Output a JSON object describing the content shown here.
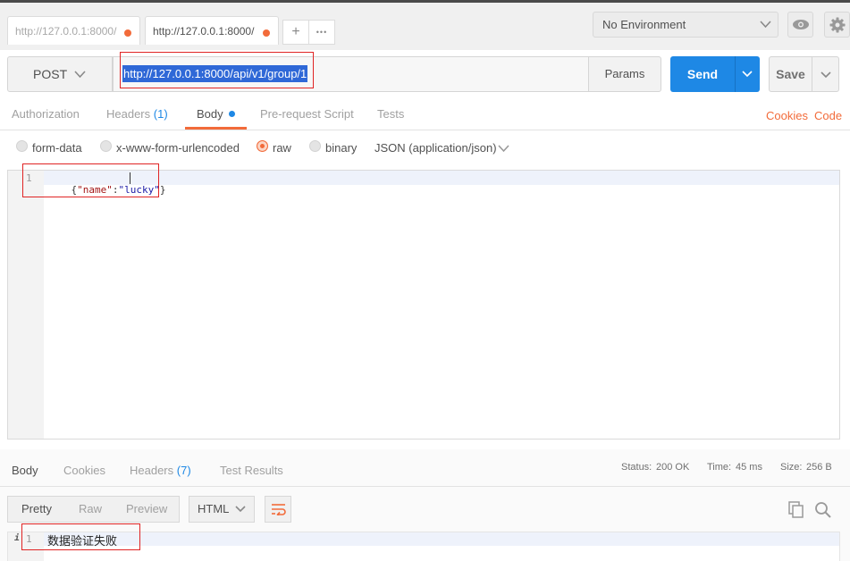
{
  "tabs": [
    {
      "label": "http://127.0.0.1:8000/"
    },
    {
      "label": "http://127.0.0.1:8000/"
    }
  ],
  "tab_add": "+",
  "tab_more": "•••",
  "environment": {
    "selected": "No Environment"
  },
  "request": {
    "method": "POST",
    "url": "http://127.0.0.1:8000/api/v1/group/1",
    "params_label": "Params",
    "send_label": "Send",
    "save_label": "Save"
  },
  "request_tabs": {
    "authorization": "Authorization",
    "headers": "Headers",
    "headers_count": "(1)",
    "body": "Body",
    "prerequest": "Pre-request Script",
    "tests": "Tests",
    "cookies": "Cookies",
    "code": "Code"
  },
  "body_types": {
    "form_data": "form-data",
    "urlencoded": "x-www-form-urlencoded",
    "raw": "raw",
    "binary": "binary",
    "raw_format": "JSON (application/json)"
  },
  "editor": {
    "line_number": "1",
    "code": "{\"name\":\"lucky\"}",
    "code_parts": [
      "{",
      "\"name\"",
      ":",
      "\"lucky\"",
      "}"
    ]
  },
  "response_tabs": {
    "body": "Body",
    "cookies": "Cookies",
    "headers": "Headers",
    "headers_count": "(7)",
    "test_results": "Test Results"
  },
  "response_status": {
    "status_label": "Status:",
    "status_value": "200 OK",
    "time_label": "Time:",
    "time_value": "45 ms",
    "size_label": "Size:",
    "size_value": "256 B"
  },
  "response_view": {
    "pretty": "Pretty",
    "raw": "Raw",
    "preview": "Preview",
    "format": "HTML"
  },
  "response_body": {
    "info_marker": "i",
    "line_number": "1",
    "text": "数据验证失败"
  },
  "colors": {
    "accent_orange": "#f26b3a",
    "send_blue": "#1e88e5",
    "highlight_red": "#e02424"
  }
}
